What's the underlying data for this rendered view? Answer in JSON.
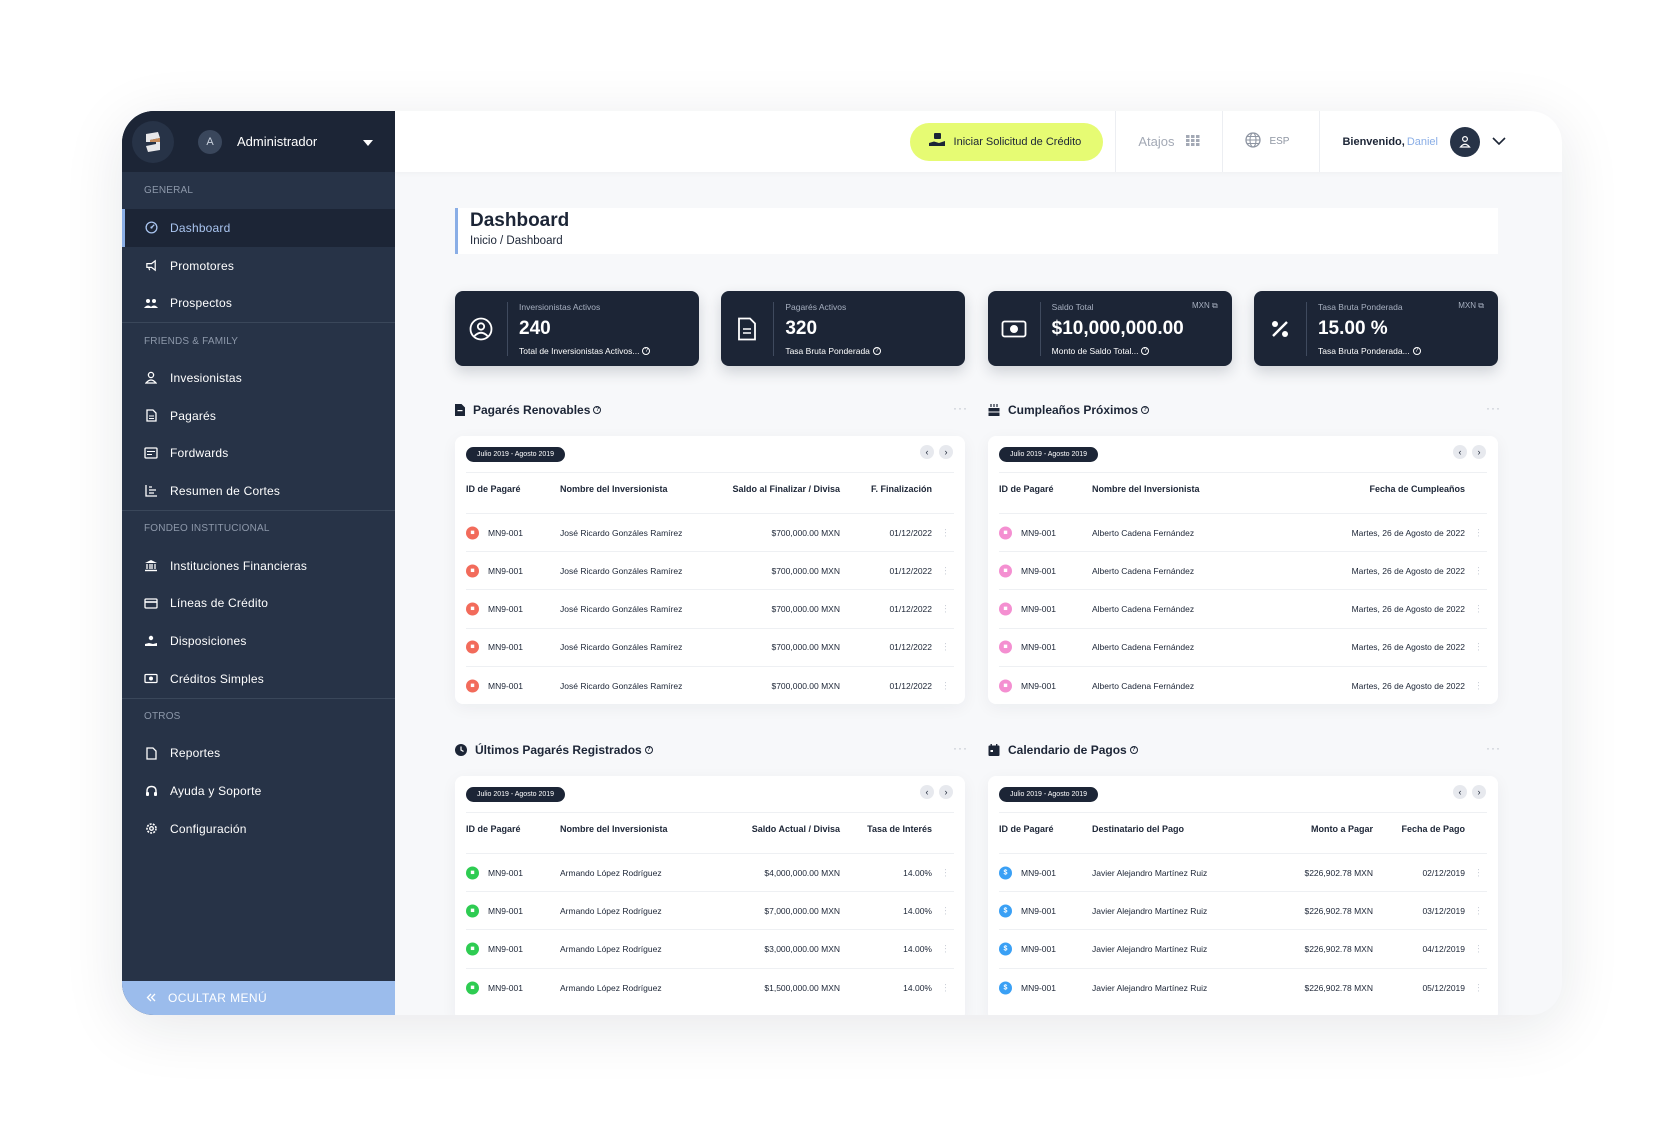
{
  "sidebar": {
    "user_initial": "A",
    "user_name": "Administrador",
    "sections": {
      "general": "GENERAL",
      "friends": "FRIENDS & FAMILY",
      "fondeo": "FONDEO INSTITUCIONAL",
      "otros": "OTROS"
    },
    "items": {
      "dashboard": "Dashboard",
      "promotores": "Promotores",
      "prospectos": "Prospectos",
      "inversionistas": "Invesionistas",
      "pagares": "Pagarés",
      "fordwards": "Fordwards",
      "resumen": "Resumen de Cortes",
      "instituciones": "Instituciones Financieras",
      "lineas": "Líneas de Crédito",
      "disposiciones": "Disposiciones",
      "creditos": "Créditos Simples",
      "reportes": "Reportes",
      "ayuda": "Ayuda y Soporte",
      "configuracion": "Configuración"
    },
    "hide_menu": "OCULTAR MENÚ"
  },
  "topbar": {
    "cta": "Iniciar Solicitud de Crédito",
    "shortcuts": "Atajos",
    "lang": "ESP",
    "welcome": "Bienvenido,",
    "user": "Daniel"
  },
  "header": {
    "title": "Dashboard",
    "breadcrumb": "Inicio / Dashboard"
  },
  "kpis": [
    {
      "label": "Inversionistas Activos",
      "value": "240",
      "sub": "Total de Inversionistas Activos...",
      "currency": ""
    },
    {
      "label": "Pagarés Activos",
      "value": "320",
      "sub": "Tasa Bruta Ponderada",
      "currency": ""
    },
    {
      "label": "Saldo Total",
      "value": "$10,000,000.00",
      "sub": "Monto de Saldo Total...",
      "currency": "MXN"
    },
    {
      "label": "Tasa Bruta Ponderada",
      "value": "15.00 %",
      "sub": "Tasa Bruta Ponderada...",
      "currency": "MXN"
    }
  ],
  "panels": {
    "renovables": {
      "title": "Pagarés Renovables",
      "range": "Julio 2019 - Agosto 2019",
      "headers": [
        "ID de Pagaré",
        "Nombre del Inversionista",
        "Saldo al Finalizar / Divisa",
        "F. Finalización"
      ],
      "rows": [
        [
          "MN9-001",
          "José Ricardo Gonzáles Ramírez",
          "$700,000.00 MXN",
          "01/12/2022"
        ],
        [
          "MN9-001",
          "José Ricardo Gonzáles Ramírez",
          "$700,000.00 MXN",
          "01/12/2022"
        ],
        [
          "MN9-001",
          "José Ricardo Gonzáles Ramírez",
          "$700,000.00 MXN",
          "01/12/2022"
        ],
        [
          "MN9-001",
          "José Ricardo Gonzáles Ramírez",
          "$700,000.00 MXN",
          "01/12/2022"
        ],
        [
          "MN9-001",
          "José Ricardo Gonzáles Ramírez",
          "$700,000.00 MXN",
          "01/12/2022"
        ]
      ]
    },
    "cumpleanos": {
      "title": "Cumpleaños Próximos",
      "range": "Julio 2019 - Agosto 2019",
      "headers": [
        "ID de Pagaré",
        "Nombre del Inversionista",
        "Fecha de Cumpleaños"
      ],
      "rows": [
        [
          "MN9-001",
          "Alberto Cadena Fernández",
          "Martes, 26 de Agosto de 2022"
        ],
        [
          "MN9-001",
          "Alberto Cadena Fernández",
          "Martes, 26 de Agosto de 2022"
        ],
        [
          "MN9-001",
          "Alberto Cadena Fernández",
          "Martes, 26 de Agosto de 2022"
        ],
        [
          "MN9-001",
          "Alberto Cadena Fernández",
          "Martes, 26 de Agosto de 2022"
        ],
        [
          "MN9-001",
          "Alberto Cadena Fernández",
          "Martes, 26 de Agosto de 2022"
        ]
      ]
    },
    "ultimos": {
      "title": "Últimos Pagarés Registrados",
      "range": "Julio 2019 - Agosto 2019",
      "headers": [
        "ID de Pagaré",
        "Nombre del Inversionista",
        "Saldo Actual / Divisa",
        "Tasa de Interés"
      ],
      "rows": [
        [
          "MN9-001",
          "Armando López Rodríguez",
          "$4,000,000.00 MXN",
          "14.00%"
        ],
        [
          "MN9-001",
          "Armando López Rodríguez",
          "$7,000,000.00 MXN",
          "14.00%"
        ],
        [
          "MN9-001",
          "Armando López Rodríguez",
          "$3,000,000.00 MXN",
          "14.00%"
        ],
        [
          "MN9-001",
          "Armando López Rodríguez",
          "$1,500,000.00 MXN",
          "14.00%"
        ]
      ]
    },
    "calendario": {
      "title": "Calendario de Pagos",
      "range": "Julio 2019 - Agosto 2019",
      "headers": [
        "ID de Pagaré",
        "Destinatario del Pago",
        "Monto a Pagar",
        "Fecha de Pago"
      ],
      "rows": [
        [
          "MN9-001",
          "Javier Alejandro Martínez Ruiz",
          "$226,902.78 MXN",
          "02/12/2019"
        ],
        [
          "MN9-001",
          "Javier Alejandro Martínez Ruiz",
          "$226,902.78 MXN",
          "03/12/2019"
        ],
        [
          "MN9-001",
          "Javier Alejandro Martínez Ruiz",
          "$226,902.78 MXN",
          "04/12/2019"
        ],
        [
          "MN9-001",
          "Javier Alejandro Martínez Ruiz",
          "$226,902.78 MXN",
          "05/12/2019"
        ]
      ]
    }
  },
  "colors": {
    "navy": "#1c2536",
    "sidebar": "#273347",
    "accent": "#8aaee6",
    "cta": "#e6fb73",
    "badge_red": "#f26b5b",
    "badge_pink": "#f48fd1",
    "badge_green": "#2ecc52",
    "badge_blue": "#3aa0f5"
  }
}
